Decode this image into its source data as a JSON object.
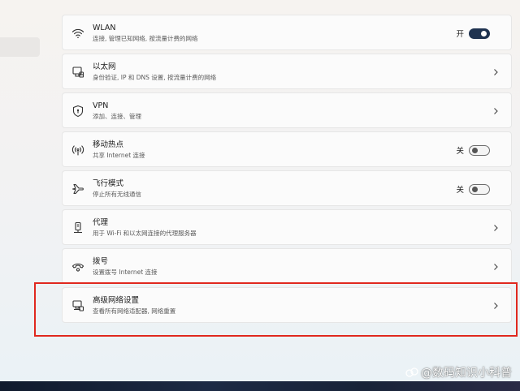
{
  "settings": {
    "items": [
      {
        "id": "wlan",
        "title": "WLAN",
        "subtitle": "连接, 管理已知网络, 按流量计费的网络",
        "icon": "wifi-icon",
        "control": "toggle",
        "toggle_label": "开",
        "toggle_state": "on"
      },
      {
        "id": "ethernet",
        "title": "以太网",
        "subtitle": "身份验证, IP 和 DNS 设置, 按流量计费的网络",
        "icon": "ethernet-icon",
        "control": "chevron"
      },
      {
        "id": "vpn",
        "title": "VPN",
        "subtitle": "添加、连接、管理",
        "icon": "shield-icon",
        "control": "chevron"
      },
      {
        "id": "hotspot",
        "title": "移动热点",
        "subtitle": "共享 Internet 连接",
        "icon": "hotspot-icon",
        "control": "toggle",
        "toggle_label": "关",
        "toggle_state": "off"
      },
      {
        "id": "airplane",
        "title": "飞行模式",
        "subtitle": "停止所有无线通信",
        "icon": "airplane-icon",
        "control": "toggle",
        "toggle_label": "关",
        "toggle_state": "off"
      },
      {
        "id": "proxy",
        "title": "代理",
        "subtitle": "用于 Wi-Fi 和以太网连接的代理服务器",
        "icon": "proxy-icon",
        "control": "chevron"
      },
      {
        "id": "dialup",
        "title": "拨号",
        "subtitle": "设置拨号 Internet 连接",
        "icon": "dialup-icon",
        "control": "chevron"
      },
      {
        "id": "advanced",
        "title": "高级网络设置",
        "subtitle": "查看所有网络适配器, 网络重置",
        "icon": "advanced-network-icon",
        "control": "chevron"
      }
    ]
  },
  "watermark": {
    "text": "@数码知识小科普",
    "icon": "watermark-logo-icon"
  },
  "colors": {
    "toggle_on": "#1f3350",
    "highlight_box": "#e0281e",
    "card_bg": "#fbfbfb"
  }
}
